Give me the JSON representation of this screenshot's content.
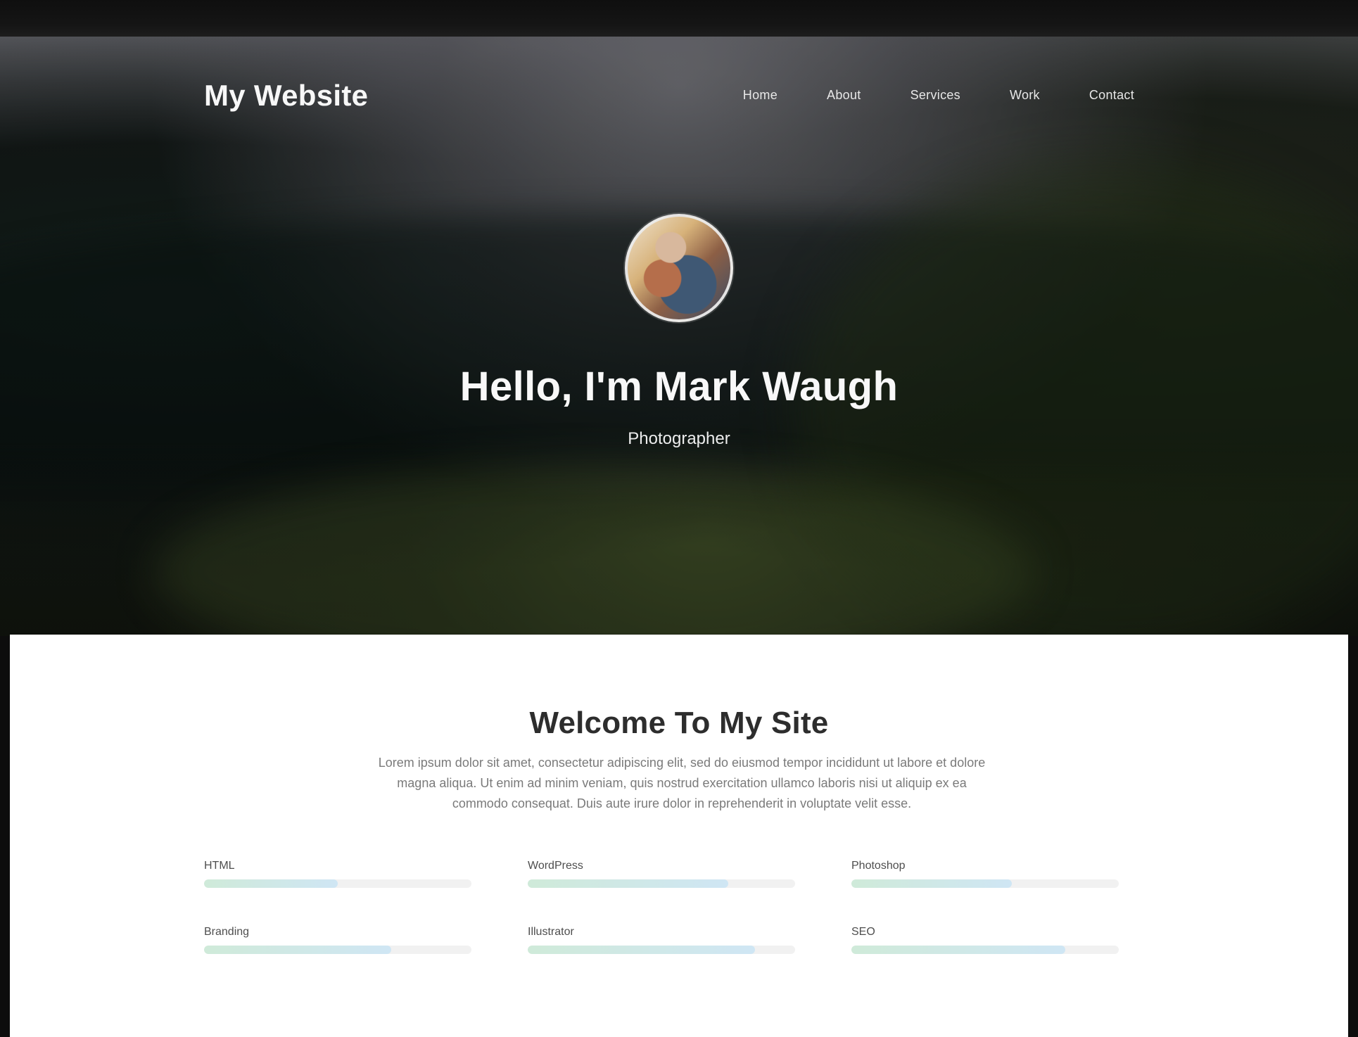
{
  "header": {
    "brand": "My Website",
    "nav_items": [
      {
        "label": "Home"
      },
      {
        "label": "About"
      },
      {
        "label": "Services"
      },
      {
        "label": "Work"
      },
      {
        "label": "Contact"
      }
    ]
  },
  "hero": {
    "title": "Hello, I'm Mark Waugh",
    "subtitle": "Photographer"
  },
  "main": {
    "title": "Welcome To My Site",
    "description": "Lorem ipsum dolor sit amet, consectetur adipiscing elit, sed do eiusmod tempor incididunt ut labore et dolore magna aliqua. Ut enim ad minim veniam, quis nostrud exercitation ullamco laboris nisi ut aliquip ex ea commodo consequat. Duis aute irure dolor in reprehenderit in voluptate velit esse.",
    "skills": [
      {
        "label": "HTML",
        "level": 50
      },
      {
        "label": "WordPress",
        "level": 75
      },
      {
        "label": "Photoshop",
        "level": 60
      },
      {
        "label": "Branding",
        "level": 70
      },
      {
        "label": "Illustrator",
        "level": 85
      },
      {
        "label": "SEO",
        "level": 80
      }
    ]
  },
  "theme": {
    "progress_start": "#cfead9",
    "progress_end": "#cfe6f4",
    "hero_text": "#ffffff",
    "page_bg": "#ffffff"
  },
  "icons": {
    "avatar": "profile-photo"
  }
}
